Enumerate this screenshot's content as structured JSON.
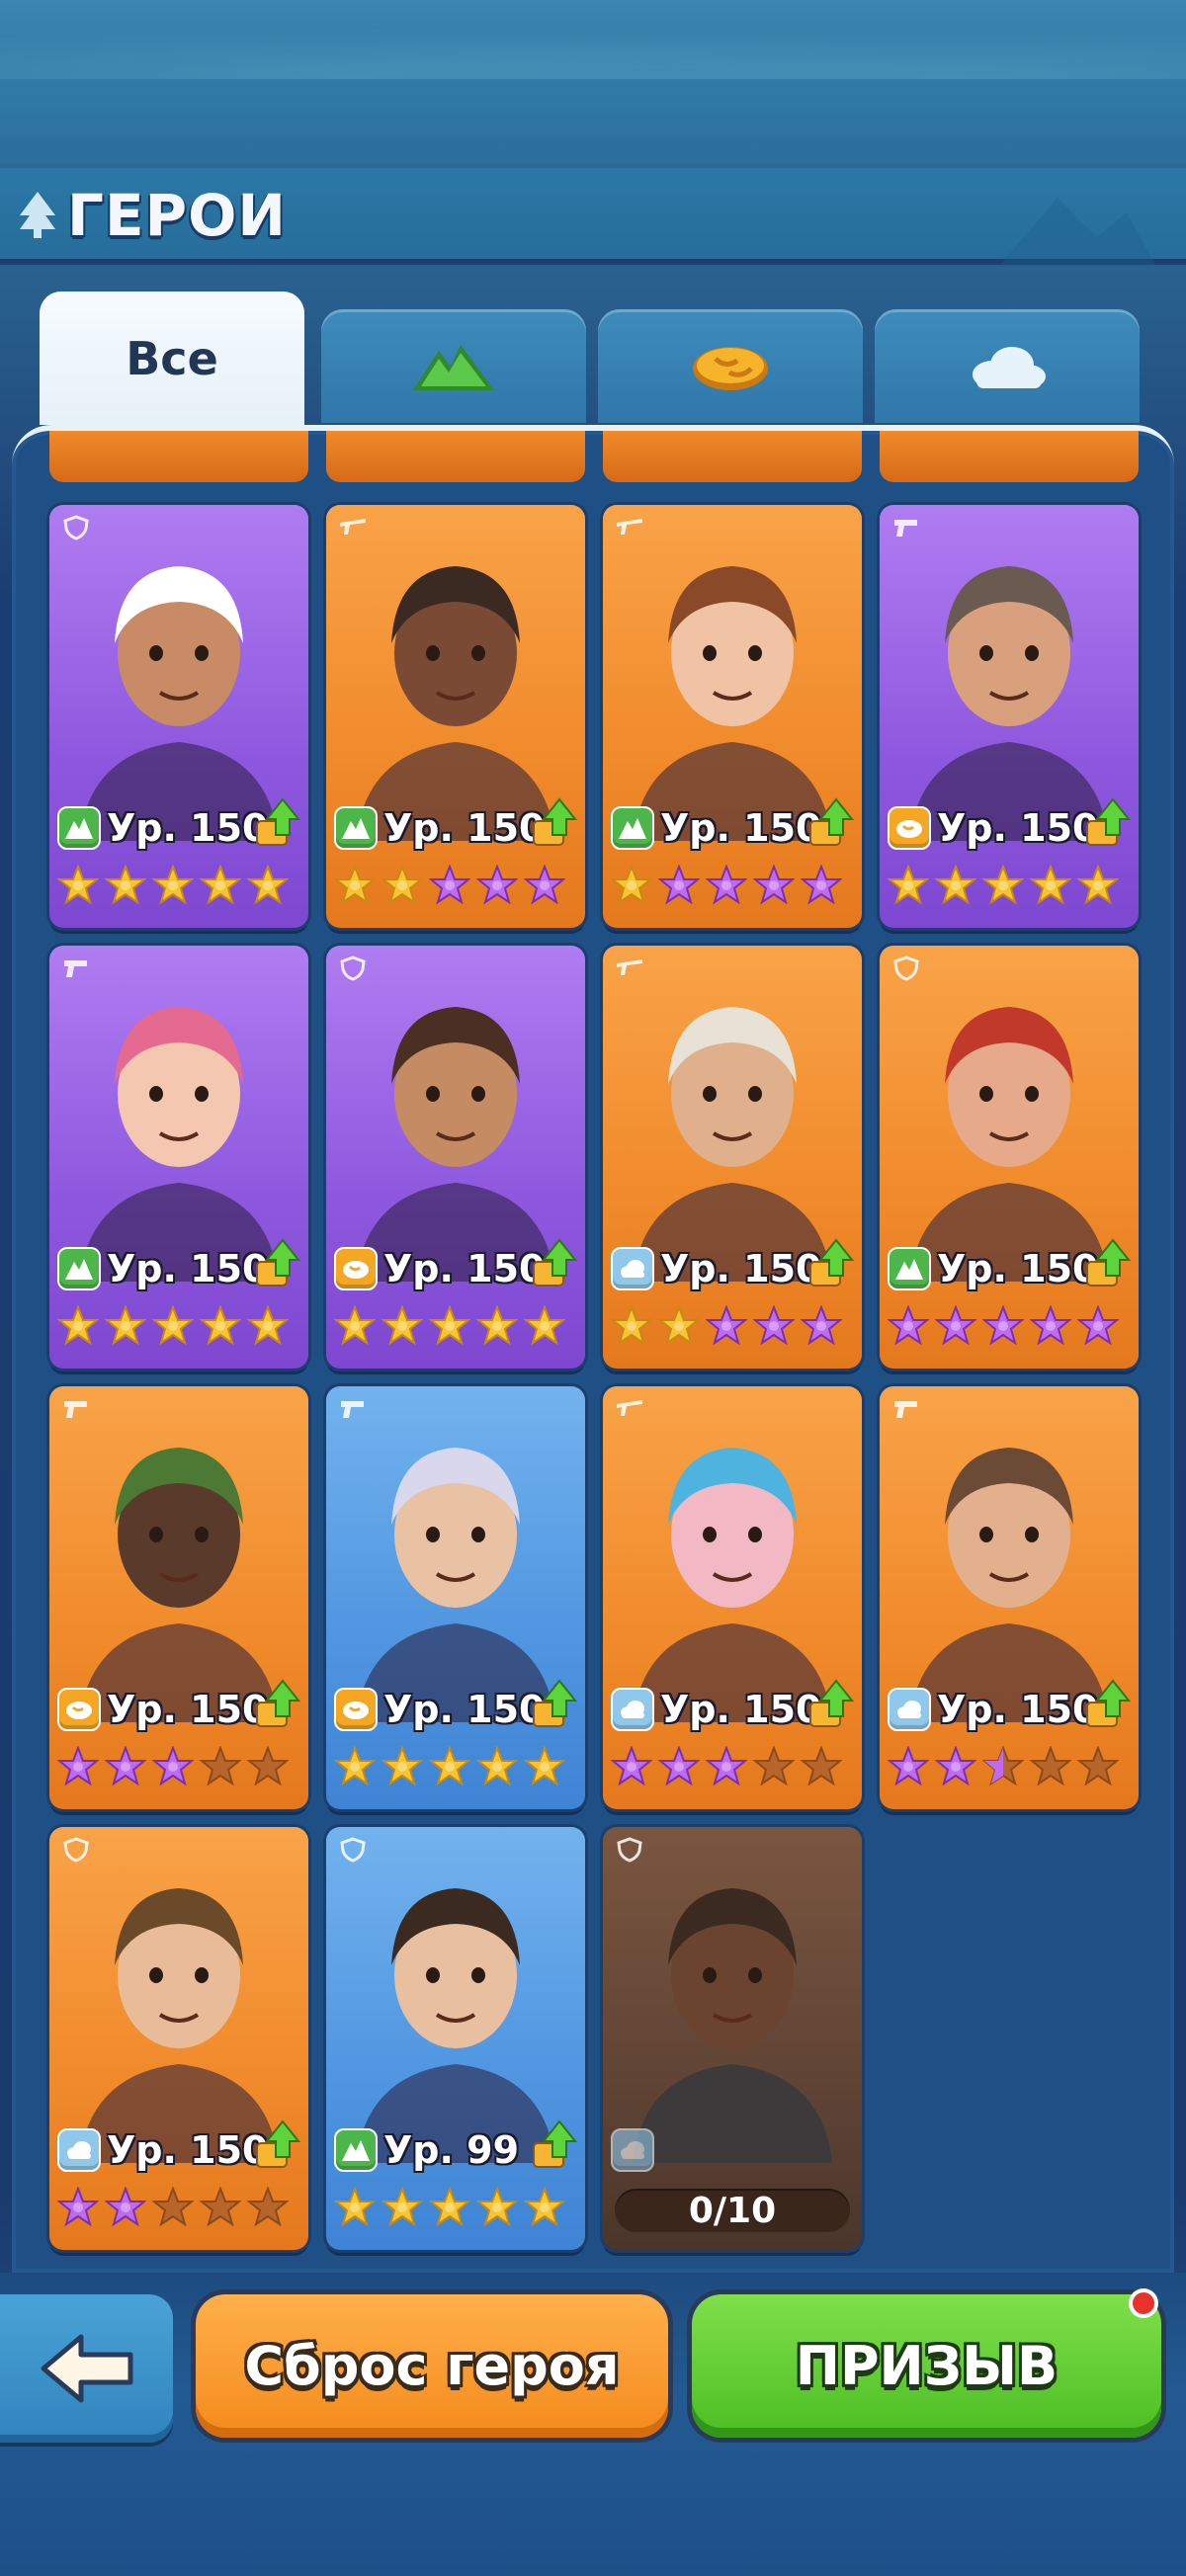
{
  "header": {
    "title": "ГЕРОИ",
    "icon": "tree-icon"
  },
  "tabs": [
    {
      "label": "Все",
      "active": true
    },
    {
      "icon": "mountain-icon",
      "color": "#4db64a"
    },
    {
      "icon": "bread-icon",
      "color": "#f5a623"
    },
    {
      "icon": "cloud-icon",
      "color": "#bfe3f7"
    }
  ],
  "heroes": [
    {
      "name": "chef",
      "bg": "purple",
      "class": "shield",
      "element": "mountain",
      "level": "Ур. 150",
      "upgrade": true,
      "stars": [
        "g",
        "g",
        "g",
        "g",
        "g"
      ]
    },
    {
      "name": "gold-chain-brawler",
      "bg": "orange",
      "class": "rifle",
      "element": "mountain",
      "level": "Ур. 150",
      "upgrade": true,
      "stars": [
        "g",
        "g",
        "p",
        "p",
        "p"
      ]
    },
    {
      "name": "fish-hat-girl",
      "bg": "orange",
      "class": "rifle",
      "element": "mountain",
      "level": "Ур. 150",
      "upgrade": true,
      "stars": [
        "g",
        "p",
        "p",
        "p",
        "p"
      ]
    },
    {
      "name": "bearded-hunter",
      "bg": "purple",
      "class": "pistol",
      "element": "bread",
      "level": "Ур. 150",
      "upgrade": true,
      "stars": [
        "g",
        "g",
        "g",
        "g",
        "g"
      ]
    },
    {
      "name": "pink-hair-swordswoman",
      "bg": "purple",
      "class": "pistol",
      "element": "mountain",
      "level": "Ур. 150",
      "upgrade": true,
      "stars": [
        "g",
        "g",
        "g",
        "g",
        "g"
      ]
    },
    {
      "name": "tattooed-fighter",
      "bg": "purple",
      "class": "shield",
      "element": "bread",
      "level": "Ур. 150",
      "upgrade": true,
      "stars": [
        "g",
        "g",
        "g",
        "g",
        "g"
      ]
    },
    {
      "name": "cap-mechanic",
      "bg": "orange",
      "class": "rifle",
      "element": "cloud",
      "level": "Ур. 150",
      "upgrade": true,
      "stars": [
        "g",
        "g",
        "p",
        "p",
        "p"
      ]
    },
    {
      "name": "red-hair-warrior",
      "bg": "orange",
      "class": "shield",
      "element": "mountain",
      "level": "Ур. 150",
      "upgrade": true,
      "stars": [
        "p",
        "p",
        "p",
        "p",
        "p"
      ]
    },
    {
      "name": "green-hood-archer",
      "bg": "orange",
      "class": "pistol",
      "element": "bread",
      "level": "Ур. 150",
      "upgrade": true,
      "stars": [
        "p",
        "p",
        "p",
        "e",
        "e"
      ]
    },
    {
      "name": "white-hoodie-boy",
      "bg": "blue",
      "class": "pistol",
      "element": "bread",
      "level": "Ур. 150",
      "upgrade": true,
      "stars": [
        "g",
        "g",
        "g",
        "g",
        "g"
      ]
    },
    {
      "name": "blue-hair-girl",
      "bg": "orange",
      "class": "rifle",
      "element": "cloud",
      "level": "Ур. 150",
      "upgrade": true,
      "stars": [
        "p",
        "p",
        "p",
        "e",
        "e"
      ]
    },
    {
      "name": "goggles-kid",
      "bg": "orange",
      "class": "pistol",
      "element": "cloud",
      "level": "Ур. 150",
      "upgrade": true,
      "stars": [
        "p",
        "p",
        "h",
        "e",
        "e"
      ]
    },
    {
      "name": "headphones-boy",
      "bg": "orange",
      "class": "shield",
      "element": "cloud",
      "level": "Ур. 150",
      "upgrade": true,
      "stars": [
        "p",
        "p",
        "e",
        "e",
        "e"
      ]
    },
    {
      "name": "neck-pillow-guy",
      "bg": "blue",
      "class": "shield",
      "element": "mountain",
      "level": "Ур. 99",
      "upgrade": true,
      "stars": [
        "g",
        "g",
        "g",
        "g",
        "g"
      ]
    },
    {
      "name": "goggles-soldier",
      "bg": "locked",
      "class": "shield",
      "element": "cloud",
      "fragments": "0/10"
    }
  ],
  "buttons": {
    "back_icon": "arrow-left-icon",
    "reset": "Сброс героя",
    "summon": "ПРИЗЫВ"
  },
  "colors": {
    "gold_star": "#f7c531",
    "purple_star": "#c06af0",
    "empty_star": "#b8652a"
  }
}
